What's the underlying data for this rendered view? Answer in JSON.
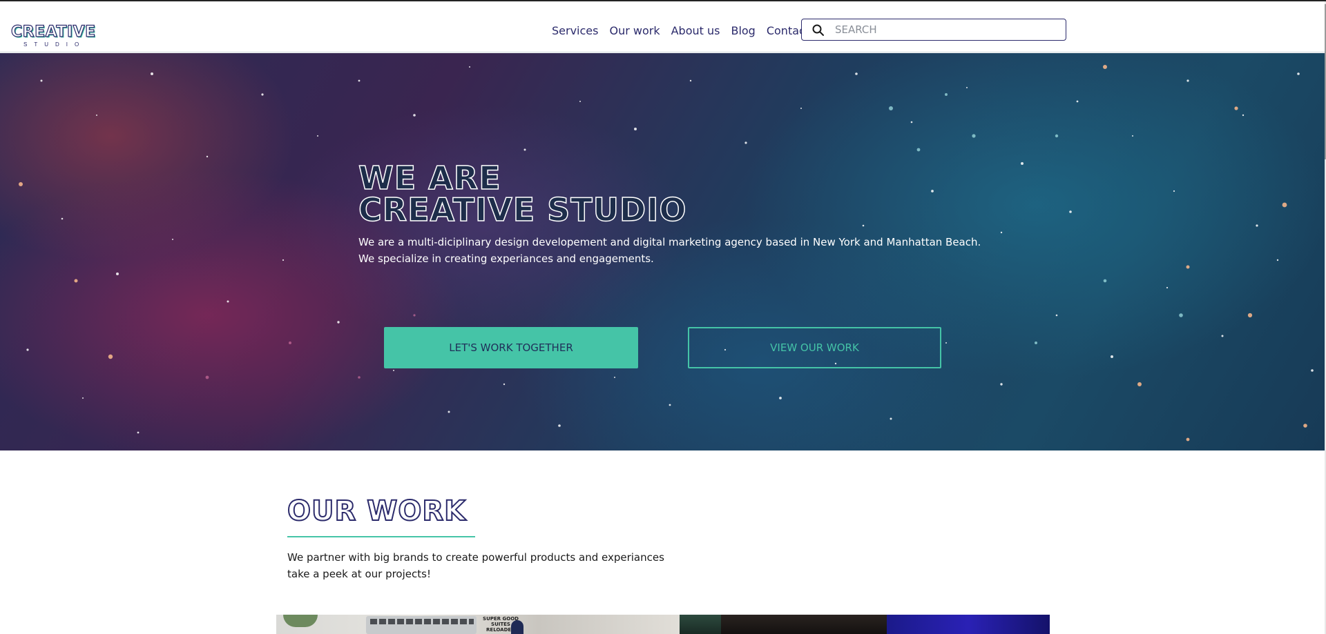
{
  "header": {
    "logo": {
      "main": "CREATIVE",
      "sub": "STUDIO"
    },
    "nav": [
      {
        "label": "Services"
      },
      {
        "label": "Our work"
      },
      {
        "label": "About us"
      },
      {
        "label": "Blog"
      },
      {
        "label": "Contact"
      }
    ],
    "search": {
      "placeholder": "SEARCH",
      "icon": "search-icon"
    }
  },
  "hero": {
    "title_line1": "WE ARE",
    "title_line2": "CREATIVE STUDIO",
    "desc_line1": "We are a multi-diciplinary design developement and digital marketing agency based in New York and Manhattan Beach.",
    "desc_line2": "We specialize in creating experiances and engagements.",
    "primary_button": "LET'S WORK TOGETHER",
    "secondary_button": "VIEW OUR WORK"
  },
  "our_work": {
    "title": "OUR WORK",
    "desc_line1": "We partner with big brands to create powerful products and experiances",
    "desc_line2": "take a peek at our projects!",
    "thumb_label": "SUPER GOOD SUITES RELOADED"
  },
  "colors": {
    "accent": "#45c4a7",
    "brand": "#2b2a6b"
  }
}
